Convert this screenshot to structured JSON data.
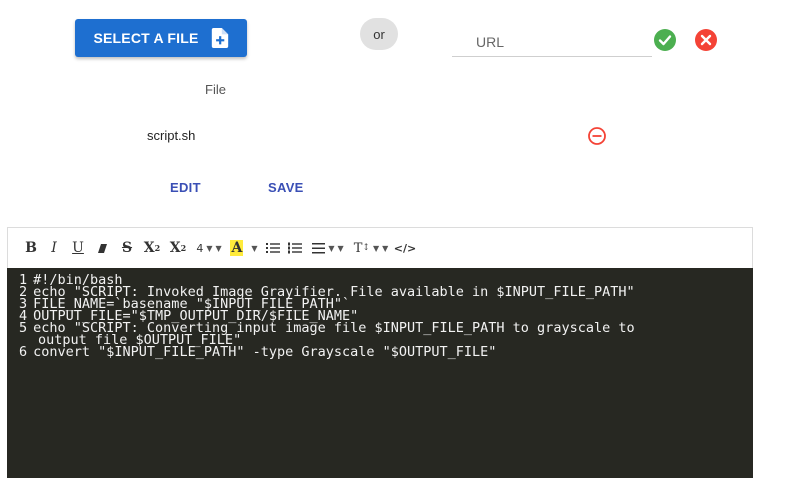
{
  "upload": {
    "select_label": "SELECT A FILE",
    "or_label": "or",
    "url_placeholder": "URL"
  },
  "file_table": {
    "header": "File",
    "file_name": "script.sh"
  },
  "actions": {
    "edit_label": "EDIT",
    "save_label": "SAVE"
  },
  "toolbar": {
    "bold": "B",
    "italic": "I",
    "underline": "U",
    "strike": "S",
    "superscript": "X",
    "subscript": "X",
    "heading_level": "4",
    "highlight": "A",
    "font_size": "T"
  },
  "code": {
    "lines": [
      {
        "n": "1",
        "text": "#!/bin/bash"
      },
      {
        "n": "2",
        "text": "echo \"SCRIPT: Invoked Image Grayifier. File available in $INPUT_FILE_PATH\""
      },
      {
        "n": "3",
        "text": "FILE_NAME=`basename \"$INPUT_FILE_PATH\"`"
      },
      {
        "n": "4",
        "text": "OUTPUT_FILE=\"$TMP_OUTPUT_DIR/$FILE_NAME\""
      },
      {
        "n": "5",
        "text": "echo \"SCRIPT: Converting input image file $INPUT_FILE_PATH to grayscale to"
      },
      {
        "n": "",
        "text": "output file $OUTPUT_FILE\""
      },
      {
        "n": "6",
        "text": "convert \"$INPUT_FILE_PATH\" -type Grayscale \"$OUTPUT_FILE\""
      }
    ]
  },
  "colors": {
    "primary": "#1e6fd0",
    "confirm": "#4caf50",
    "cancel": "#f44336",
    "link": "#3a4fb5",
    "editor_bg": "#272822"
  }
}
